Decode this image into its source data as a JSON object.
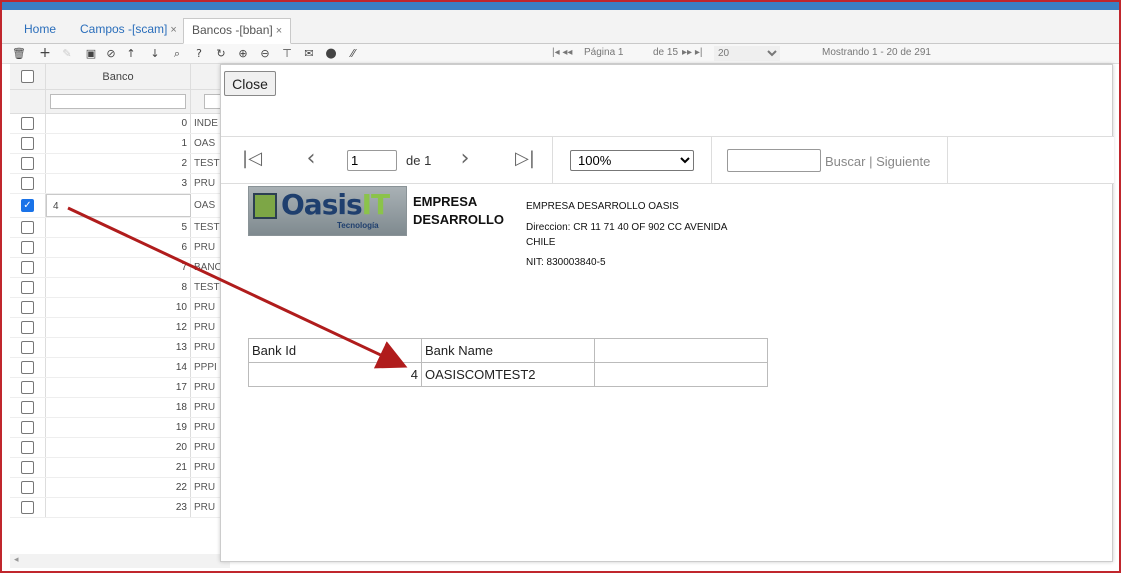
{
  "tabs": [
    {
      "label": "Home",
      "closable": false,
      "active": false
    },
    {
      "label": "Campos -[scam]",
      "closable": true,
      "active": false
    },
    {
      "label": "Bancos -[bban]",
      "closable": true,
      "active": true
    }
  ],
  "tab_close_glyph": "×",
  "toolbar": {
    "icons": [
      "trash-icon",
      "plus-icon",
      "edit-icon",
      "save-icon",
      "cancel-icon",
      "arrow-up-icon",
      "arrow-down-icon",
      "search-icon",
      "help-icon",
      "refresh-icon",
      "zoom-in-icon",
      "zoom-out-icon",
      "pin-icon",
      "mail-icon",
      "add-circle-icon",
      "resize-icon"
    ],
    "pager_page_label": "Página 1",
    "pager_of_label": "de 15",
    "page_size": "20",
    "showing_label": "Mostrando 1 - 20 de 291"
  },
  "grid": {
    "column_banco": "Banco",
    "rows": [
      {
        "id": "0",
        "name": "INDE"
      },
      {
        "id": "1",
        "name": "OAS"
      },
      {
        "id": "2",
        "name": "TEST"
      },
      {
        "id": "3",
        "name": "PRU"
      },
      {
        "id": "4",
        "name": "OAS",
        "selected": true
      },
      {
        "id": "5",
        "name": "TEST"
      },
      {
        "id": "6",
        "name": "PRU"
      },
      {
        "id": "7",
        "name": "BANC"
      },
      {
        "id": "8",
        "name": "TEST"
      },
      {
        "id": "10",
        "name": "PRU"
      },
      {
        "id": "12",
        "name": "PRU"
      },
      {
        "id": "13",
        "name": "PRU"
      },
      {
        "id": "14",
        "name": "PPPI"
      },
      {
        "id": "17",
        "name": "PRU"
      },
      {
        "id": "18",
        "name": "PRU"
      },
      {
        "id": "19",
        "name": "PRU"
      },
      {
        "id": "20",
        "name": "PRU"
      },
      {
        "id": "21",
        "name": "PRU"
      },
      {
        "id": "22",
        "name": "PRU"
      },
      {
        "id": "23",
        "name": "PRU"
      }
    ],
    "footer_glyph": "◂"
  },
  "modal": {
    "close_label": "Close",
    "page_value": "1",
    "page_of_label": "de 1",
    "zoom_value": "100%",
    "search_placeholder": "",
    "search_label": "Buscar",
    "search_sep": "|",
    "next_label": "Siguiente"
  },
  "report": {
    "logo_text_a": "Oasis",
    "logo_text_b": "IT",
    "logo_sub": "Tecnología",
    "company_short_line1": "EMPRESA",
    "company_short_line2": "DESARROLLO",
    "company_full": "EMPRESA DESARROLLO OASIS",
    "address": "Direccion:  CR 11 71 40 OF 902 CC AVENIDA CHILE",
    "nit": "NIT: 830003840-5",
    "table": {
      "headers": [
        "Bank Id",
        "Bank Name",
        ""
      ],
      "row": [
        "4",
        "OASISCOMTEST2",
        ""
      ]
    }
  },
  "colors": {
    "frame": "#c0262d",
    "topbar": "#3b7fc4",
    "link": "#2a6ebb",
    "arrow": "#b01c1c"
  }
}
